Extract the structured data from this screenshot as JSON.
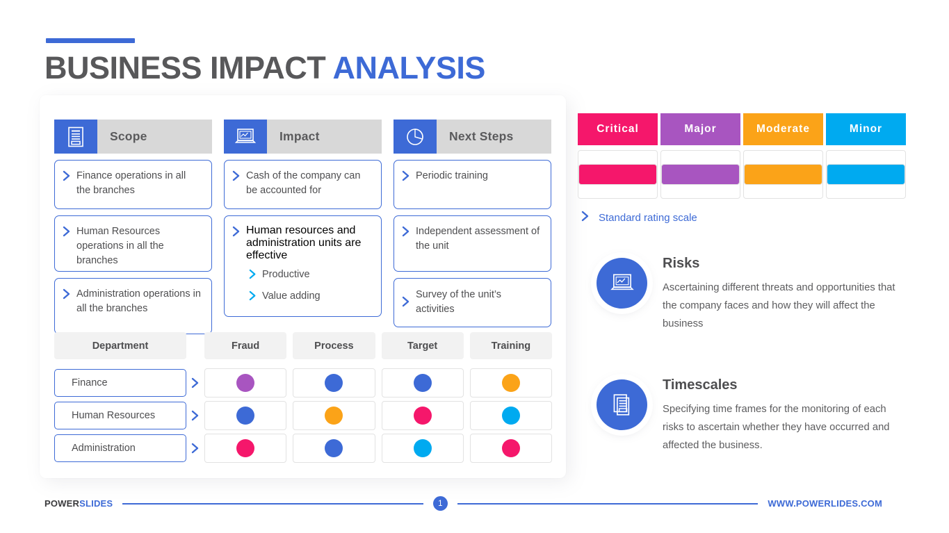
{
  "title": {
    "main": "BUSINESS IMPACT ",
    "highlight": "ANALYSIS"
  },
  "columns": [
    {
      "icon": "document-list-icon",
      "label": "Scope",
      "items": [
        {
          "text": "Finance operations in all the branches"
        },
        {
          "text": "Human Resources operations in all the branches"
        },
        {
          "text": "Administration operations in all the branches"
        }
      ]
    },
    {
      "icon": "laptop-chart-icon",
      "label": "Impact",
      "items": [
        {
          "text": "Cash of the company can be accounted for"
        },
        {
          "text": "Human resources and administration units are effective",
          "subitems": [
            "Productive",
            "Value adding"
          ]
        }
      ]
    },
    {
      "icon": "pie-chart-icon",
      "label": "Next Steps",
      "items": [
        {
          "text": "Periodic training"
        },
        {
          "text": "Independent assessment of the unit"
        },
        {
          "text": "Survey of the unit’s activities"
        }
      ]
    }
  ],
  "matrix": {
    "department_header": "Department",
    "columns": [
      "Fraud",
      "Process",
      "Target",
      "Training"
    ],
    "rows": [
      {
        "department": "Finance",
        "ratings": [
          "major",
          "blue",
          "blue",
          "moderate"
        ]
      },
      {
        "department": "Human Resources",
        "ratings": [
          "blue",
          "moderate",
          "critical",
          "minor"
        ]
      },
      {
        "department": "Administration",
        "ratings": [
          "critical",
          "blue",
          "minor",
          "critical"
        ]
      }
    ]
  },
  "legend": {
    "levels": [
      {
        "label": "Critical",
        "color": "#F5176B"
      },
      {
        "label": "Major",
        "color": "#A855C0"
      },
      {
        "label": "Moderate",
        "color": "#FBA318"
      },
      {
        "label": "Minor",
        "color": "#00AAF0"
      }
    ],
    "link": "Standard rating scale"
  },
  "rating_colors": {
    "critical": "#F5176B",
    "major": "#A855C0",
    "moderate": "#FBA318",
    "minor": "#00AAF0",
    "blue": "#3D6AD6"
  },
  "info": [
    {
      "icon": "laptop-chart-icon",
      "heading": "Risks",
      "body": "Ascertaining different threats and opportunities that the company faces and how they will affect the business"
    },
    {
      "icon": "document-list-icon",
      "heading": "Timescales",
      "body": "Specifying time frames for the monitoring of each risks to ascertain whether they have occurred and affected the business."
    }
  ],
  "footer": {
    "brand_dark": "POWER",
    "brand_light": "SLIDES",
    "page": "1",
    "site": "WWW.POWERLIDES.COM"
  },
  "theme": {
    "accent": "#3D6AD6",
    "header_gray": "#D8D8D8",
    "text": "#4E4E50"
  }
}
